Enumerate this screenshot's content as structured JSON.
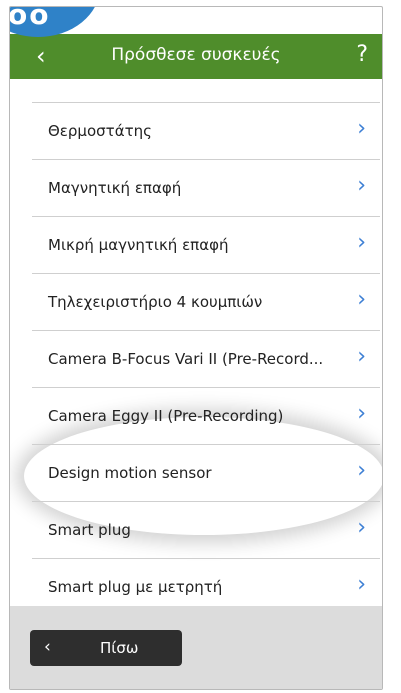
{
  "badge": {
    "text": "oo"
  },
  "header": {
    "back_icon": "‹",
    "title": "Πρόσθεσε συσκευές",
    "help": "?"
  },
  "items": [
    {
      "label": "Θερμοστάτης"
    },
    {
      "label": "Μαγνητική επαφή"
    },
    {
      "label": "Μικρή μαγνητική επαφή"
    },
    {
      "label": "Τηλεχειριστήριο 4 κουμπιών"
    },
    {
      "label": "Camera B-Focus Vari II (Pre-Record..."
    },
    {
      "label": "Camera Eggy II (Pre-Recording)"
    },
    {
      "label": "Design motion sensor"
    },
    {
      "label": "Smart plug"
    },
    {
      "label": "Smart plug με μετρητή"
    }
  ],
  "chevron": "›",
  "footer": {
    "back_label": "Πίσω",
    "back_icon": "‹"
  },
  "colors": {
    "header": "#4f8d2b",
    "chevron": "#3d7fd4",
    "badge": "#2f82c8"
  }
}
